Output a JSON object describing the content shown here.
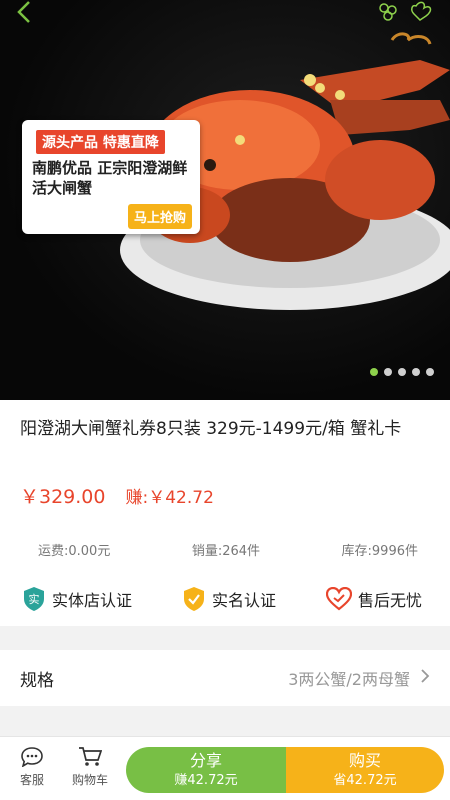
{
  "hero": {
    "promo_tag": "源头产品 特惠直降",
    "promo_desc": "南鹏优品 正宗阳澄湖鲜活大闸蟹",
    "promo_button": "马上抢购",
    "carousel_active_index": 0,
    "carousel_count": 5,
    "back_icon": "chevron-left-icon",
    "favorite_icon": "heart-outline-icon"
  },
  "product": {
    "title": "阳澄湖大闸蟹礼券8只装 329元-1499元/箱 蟹礼卡",
    "price": "￥329.00",
    "earn": "赚:￥42.72",
    "shipping": "运费:0.00元",
    "sales": "销量:264件",
    "stock": "库存:9996件"
  },
  "badges": [
    {
      "icon": "shop-verified-icon",
      "label": "实体店认证",
      "icon_text": "实",
      "color": "#2aa39a"
    },
    {
      "icon": "realname-verified-icon",
      "label": "实名认证",
      "color": "#f6b219"
    },
    {
      "icon": "after-sales-heart-icon",
      "label": "售后无忧",
      "color": "#e8452c"
    }
  ],
  "spec": {
    "label": "规格",
    "value": "3两公蟹/2两母蟹"
  },
  "bottom_bar": {
    "service_label": "客服",
    "cart_label": "购物车",
    "share_label": "分享",
    "share_sub": "赚42.72元",
    "buy_label": "购买",
    "buy_sub": "省42.72元"
  },
  "colors": {
    "accent_green": "#78bf45",
    "accent_orange": "#f6b219",
    "price_red": "#e8452c"
  }
}
